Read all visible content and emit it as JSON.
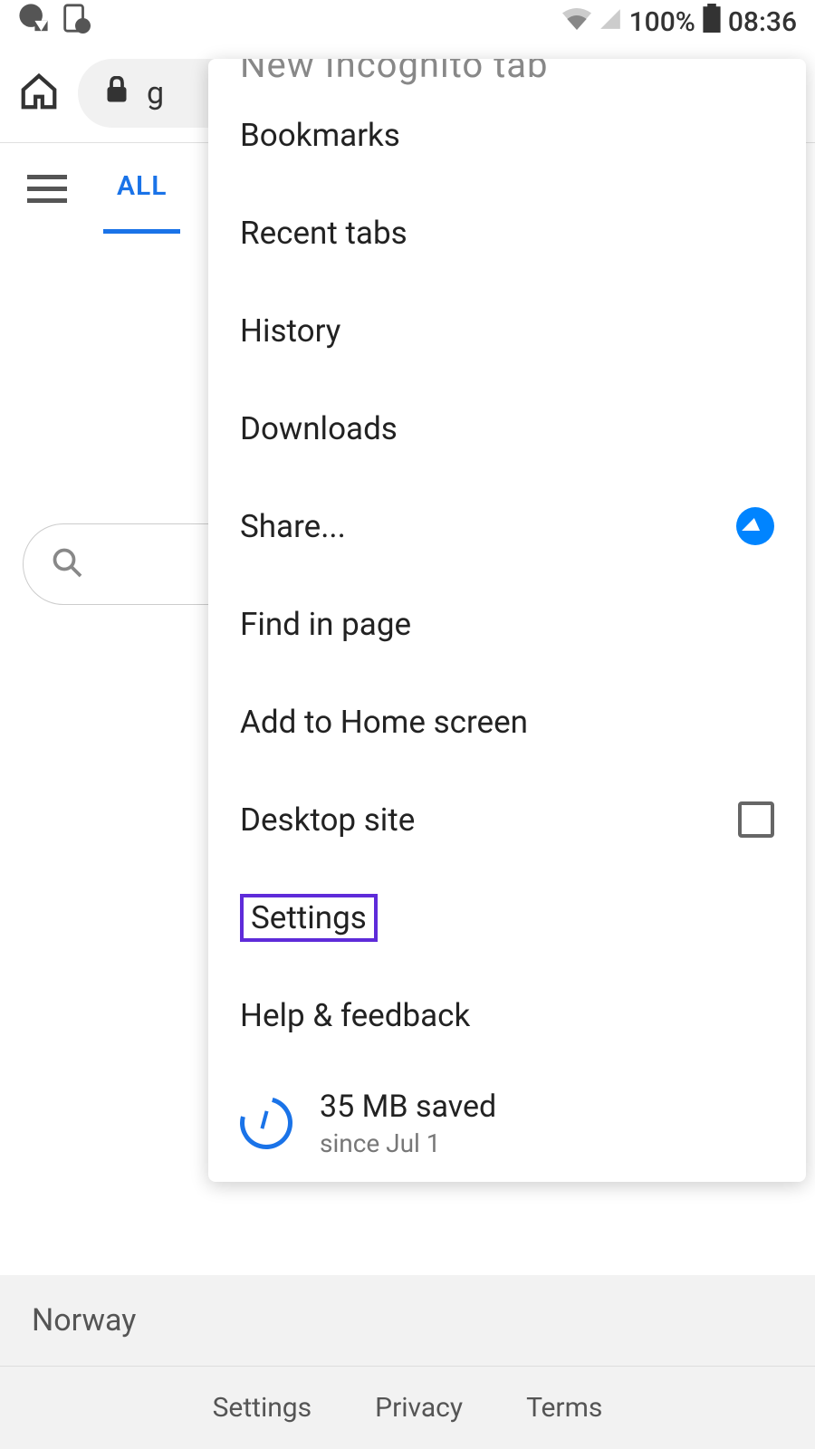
{
  "status_bar": {
    "battery": "100%",
    "time": "08:36"
  },
  "url_bar": {
    "text": "g"
  },
  "tabs": {
    "all": "ALL"
  },
  "menu": {
    "cut_item": "New Incognito tab",
    "items": [
      "Bookmarks",
      "Recent tabs",
      "History",
      "Downloads",
      "Share...",
      "Find in page",
      "Add to Home screen",
      "Desktop site",
      "Settings",
      "Help & feedback"
    ],
    "data_saver": {
      "title": "35 MB saved",
      "subtitle": "since Jul 1"
    }
  },
  "footer": {
    "location": "Norway",
    "links": [
      "Settings",
      "Privacy",
      "Terms"
    ]
  }
}
